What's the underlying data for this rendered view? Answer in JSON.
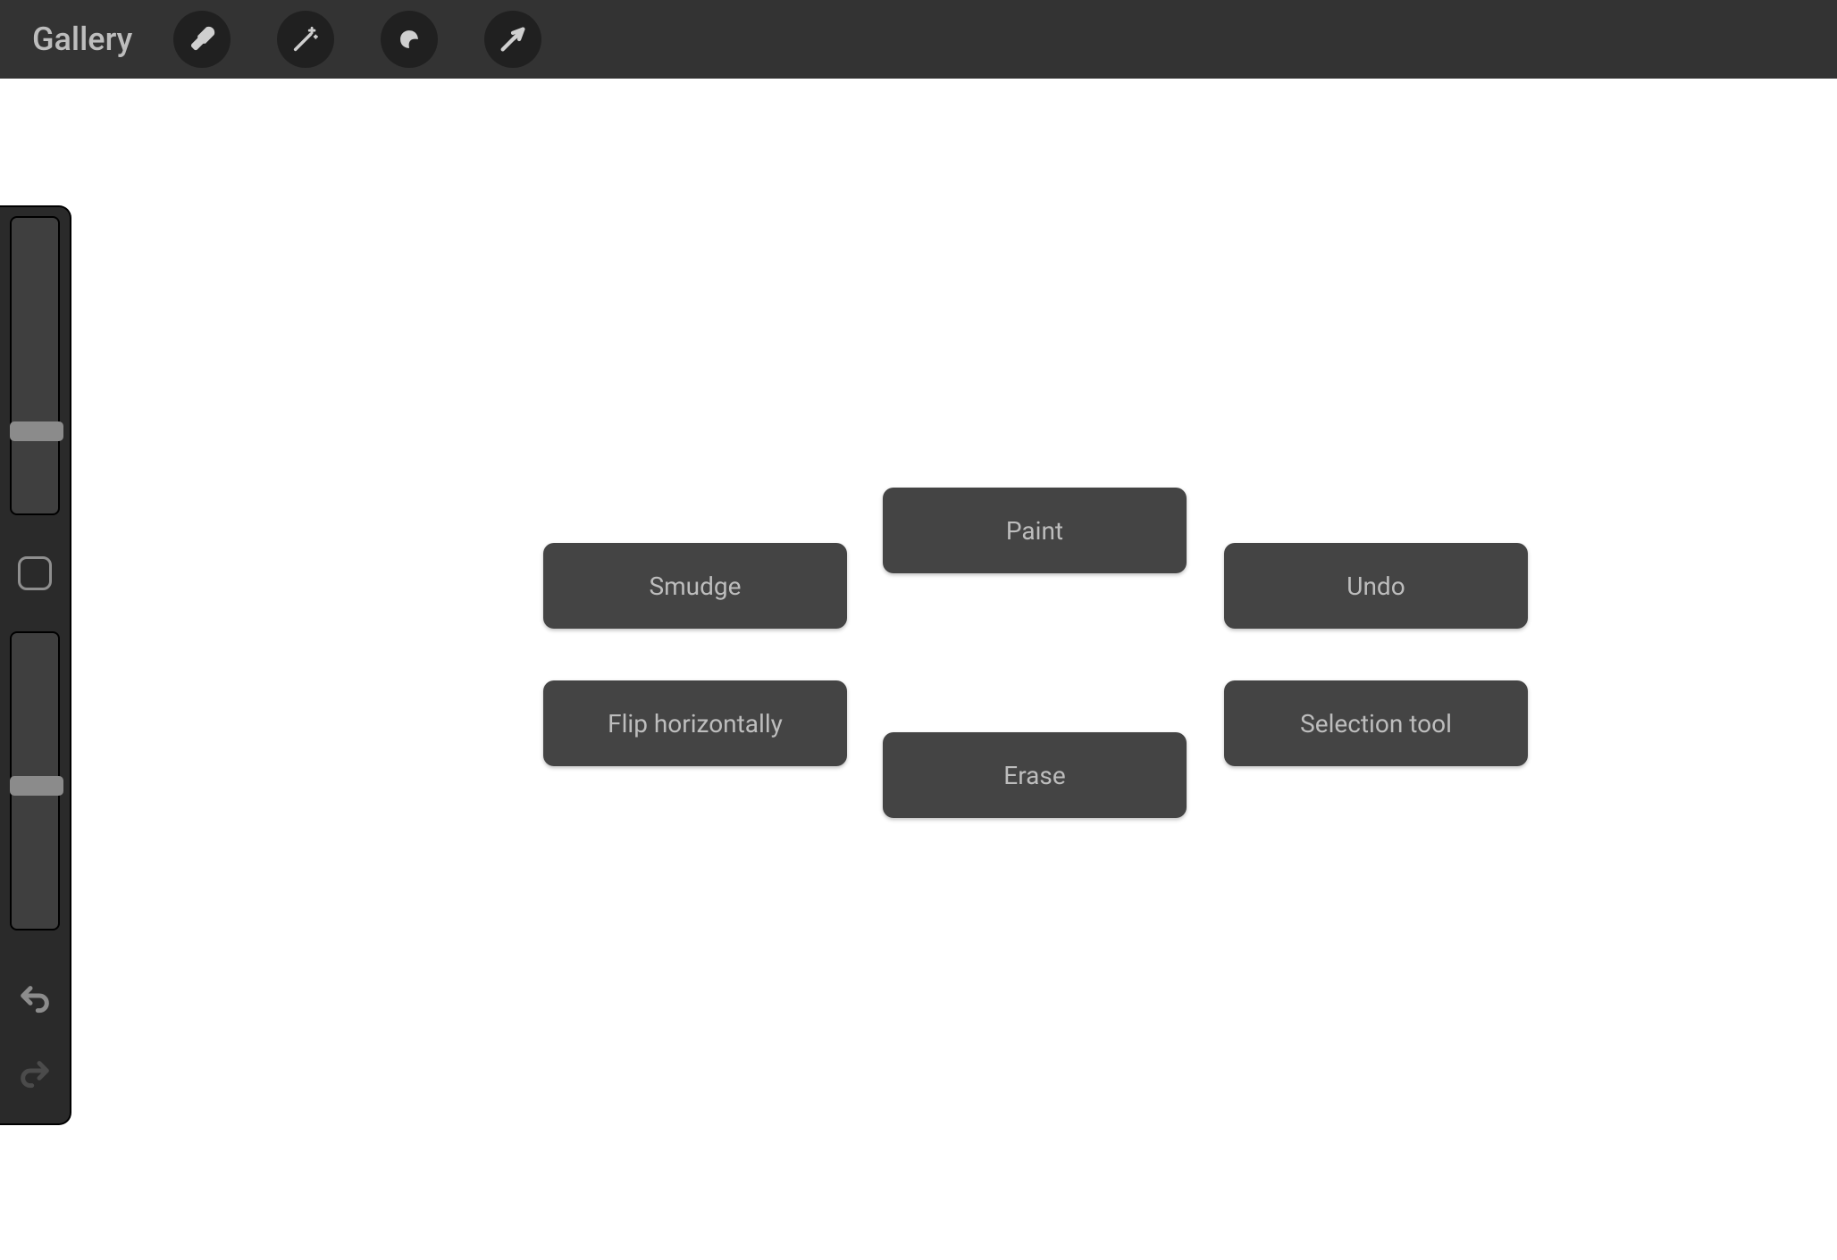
{
  "topbar": {
    "gallery_label": "Gallery",
    "icons": {
      "wrench": "wrench-icon",
      "wand": "wand-icon",
      "selection": "selection-icon",
      "arrow": "arrow-icon"
    }
  },
  "sidepanel": {
    "brush_size_slider": {
      "value_percent": 68
    },
    "opacity_slider": {
      "value_percent": 48
    },
    "modify_button": "modify",
    "undo_enabled": true,
    "redo_enabled": false
  },
  "gesture_chips": {
    "smudge": "Smudge",
    "paint": "Paint",
    "undo": "Undo",
    "flip_horizontally": "Flip horizontally",
    "erase": "Erase",
    "selection_tool": "Selection tool"
  },
  "colors": {
    "topbar_bg": "#333333",
    "panel_bg": "#2a2a2a",
    "chip_bg": "#444444",
    "chip_text": "#bdbdbd",
    "icon_fg": "#cfcfcf"
  }
}
